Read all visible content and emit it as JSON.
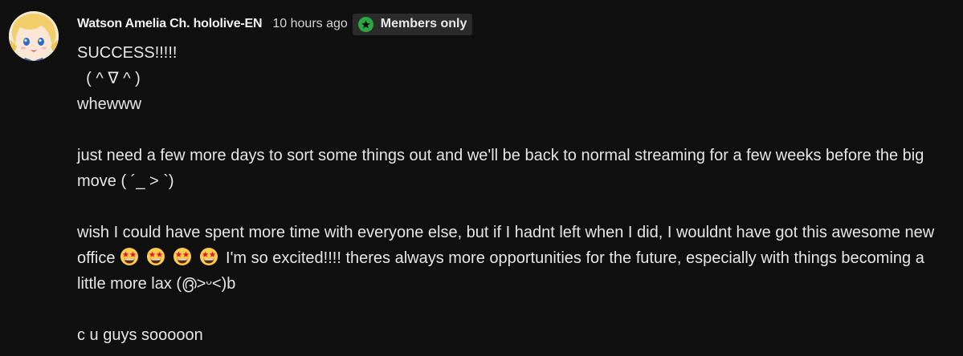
{
  "comment": {
    "author": "Watson Amelia Ch. hololive-EN",
    "timestamp": "10 hours ago",
    "badge": {
      "icon": "star-icon",
      "label": "Members only",
      "color": "#2ba640"
    },
    "avatar_icon": "avatar-anime-girl",
    "lines": {
      "l1": "SUCCESS!!!!!",
      "l2": "  ( ^ ∇ ^ )",
      "l3": "whewww",
      "p2": "just need a few more days to sort some things out and we'll be back to normal streaming for a few weeks before the big move ( ´_ > `)",
      "p3_before": "wish I could have spent more time with everyone else, but if I hadnt left when I did, I wouldnt have got this awesome new office",
      "p3_after": "I'm so excited!!!! theres always more opportunities for the future, especially with things becoming a little more lax (൫>ᵕ<)b",
      "p4": "c u guys sooooon"
    },
    "emoji_name": "star-struck-emoji"
  }
}
